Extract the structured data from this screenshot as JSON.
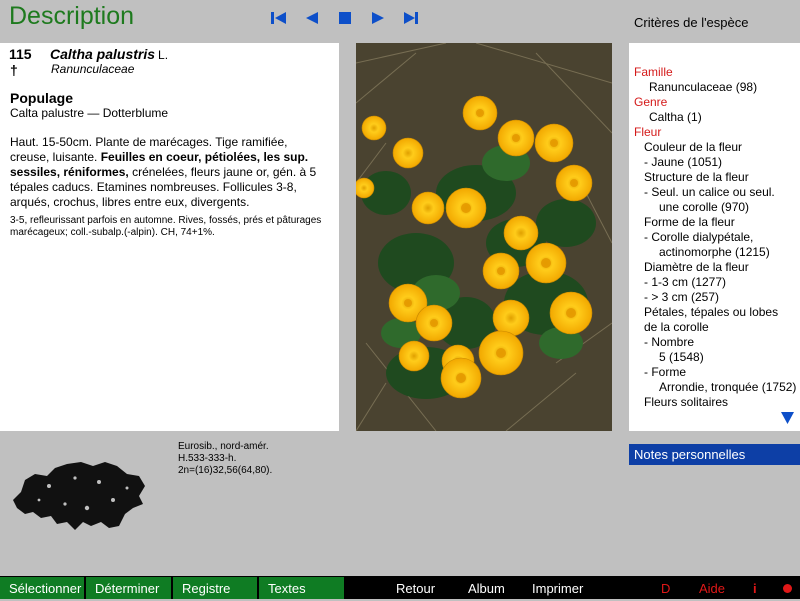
{
  "header": {
    "title": "Description",
    "criteria_title": "Critères de l'espèce",
    "nav": [
      {
        "icon": "first-record-icon"
      },
      {
        "icon": "previous-record-icon"
      },
      {
        "icon": "stop-icon"
      },
      {
        "icon": "next-record-icon"
      },
      {
        "icon": "last-record-icon"
      }
    ]
  },
  "species": {
    "number": "115",
    "dagger": "†",
    "genus_species": "Caltha palustris",
    "author": "L.",
    "family": "Ranunculaceae",
    "common_name": "Populage",
    "common_sub": "Calta palustre — Dotterblume",
    "desc_plain1": "Haut. 15-50cm. Plante de marécages. Tige ramifiée, creuse, luisante. ",
    "desc_bold": "Feuilles en coeur, pétiolées, les sup. sessiles, réniformes,",
    "desc_plain2": " crénelées, fleurs jaune or, gén. à 5 tépales caducs. Etamines nombreuses. Follicules 3-8, arqués, crochus, libres entre eux, divergents.",
    "ecology": "3-5, refleurissant parfois en automne. Rives, fossés, prés et pâturages marécageux; coll.-subalp.(-alpin). CH, 74+1%.",
    "distribution": [
      "Eurosib., nord-amér.",
      "H.533-333-h.",
      "2n=(16)32,56(64,80)."
    ]
  },
  "criteria": [
    {
      "cls": "cat",
      "text": "Famille"
    },
    {
      "cls": "l1",
      "text": "Ranunculaceae (98)"
    },
    {
      "cls": "cat",
      "text": "Genre"
    },
    {
      "cls": "l1",
      "text": "Caltha (1)"
    },
    {
      "cls": "cat",
      "text": "Fleur"
    },
    {
      "cls": "l1b",
      "text": "Couleur de la fleur"
    },
    {
      "cls": "l2",
      "text": "-  Jaune (1051)"
    },
    {
      "cls": "l1b",
      "text": "Structure de la fleur"
    },
    {
      "cls": "l2",
      "text": "-  Seul. un calice ou seul."
    },
    {
      "cls": "l3",
      "text": "une corolle (970)"
    },
    {
      "cls": "l1b",
      "text": "Forme de la fleur"
    },
    {
      "cls": "l2",
      "text": "-  Corolle dialypétale,"
    },
    {
      "cls": "l3",
      "text": "actinomorphe (1215)"
    },
    {
      "cls": "l1b",
      "text": "Diamètre de la fleur"
    },
    {
      "cls": "l2",
      "text": "-  1-3 cm (1277)"
    },
    {
      "cls": "l2",
      "text": "-  > 3 cm (257)"
    },
    {
      "cls": "l1b",
      "text": "Pétales, tépales ou lobes"
    },
    {
      "cls": "l1b",
      "text": "de la corolle"
    },
    {
      "cls": "l2",
      "text": "-  Nombre"
    },
    {
      "cls": "l3",
      "text": "5 (1548)"
    },
    {
      "cls": "l2",
      "text": "-  Forme"
    },
    {
      "cls": "l3",
      "text": "Arrondie, tronquée (1752)"
    },
    {
      "cls": "l1b",
      "text": "Fleurs solitaires"
    }
  ],
  "notes_label": "Notes personnelles",
  "bottom": {
    "select": "Sélectionner",
    "determine": "Déterminer",
    "register": "Registre",
    "texts": "Textes",
    "back": "Retour",
    "album": "Album",
    "print": "Imprimer",
    "d": "D",
    "help": "Aide",
    "info": "i"
  },
  "colors": {
    "title_green": "#1e7a1e",
    "tab_green": "#0f7c23",
    "nav_blue": "#0d4fc9",
    "notes_blue": "#0d3fa6",
    "criteria_red": "#d41a1a",
    "flower_yellow": "#f6b80c"
  }
}
